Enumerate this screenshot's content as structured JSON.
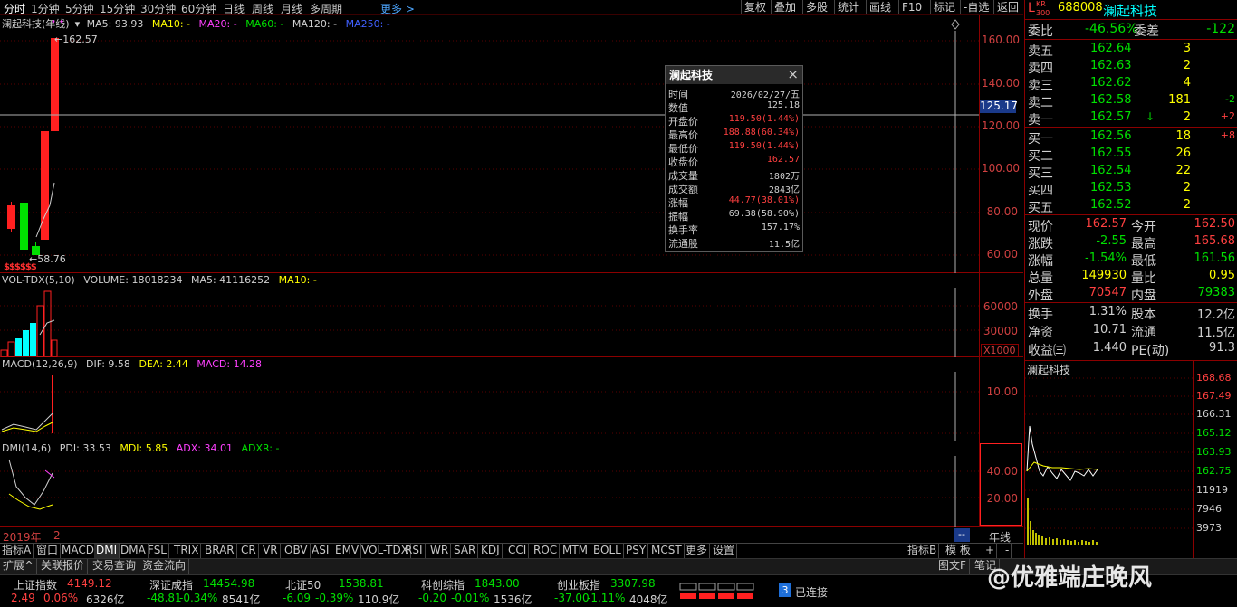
{
  "toolbar": {
    "periods": [
      "分时",
      "1分钟",
      "5分钟",
      "15分钟",
      "30分钟",
      "60分钟",
      "日线",
      "周线",
      "月线",
      "多周期",
      "更多 >"
    ],
    "right_buttons": [
      "复权",
      "叠加",
      "多股",
      "统计",
      "画线",
      "F10",
      "标记",
      "-自选",
      "返回"
    ]
  },
  "main_chart": {
    "stock_label": "澜起科技(年线)",
    "ma5": "MA5: 93.93",
    "ma10": "MA10: -",
    "ma20": "MA20: -",
    "ma60": "MA60: -",
    "ma120": "MA120: -",
    "ma250": "MA250: -",
    "high_annot": "162.57",
    "low_annot": "58.76",
    "cursor_value": "125.17",
    "y_ticks": [
      "160.00",
      "140.00",
      "120.00",
      "100.00",
      "80.00",
      "60.00"
    ],
    "signal_marks": "$$$$$$"
  },
  "vol_chart": {
    "label": "VOL-TDX(5,10)",
    "volume": "VOLUME: 18018234",
    "ma5": "MA5: 41116252",
    "ma10": "MA10: -",
    "y_ticks": [
      "60000",
      "30000"
    ],
    "unit": "X1000"
  },
  "macd_chart": {
    "label": "MACD(12,26,9)",
    "dif": "DIF: 9.58",
    "dea": "DEA: 2.44",
    "macd": "MACD: 14.28",
    "y_ticks": [
      "10.00"
    ]
  },
  "dmi_chart": {
    "label": "DMI(14,6)",
    "pdi": "PDI: 33.53",
    "mdi": "MDI: 5.85",
    "adx": "ADX: 34.01",
    "adxr": "ADXR: -",
    "y_ticks": [
      "40.00",
      "20.00"
    ]
  },
  "x_axis": {
    "year_label": "2019年",
    "year_label2": "2",
    "period_name": "年线",
    "scroll_marker": "--"
  },
  "popup": {
    "title": "澜起科技",
    "close": "×",
    "rows": [
      {
        "k": "时间",
        "v": "2026/02/27/五",
        "c": "#d0d0d0"
      },
      {
        "k": "数值",
        "v": "125.18",
        "c": "#d0d0d0"
      },
      {
        "k": "开盘价",
        "v": "119.50(1.44%)",
        "c": "#ff4040"
      },
      {
        "k": "最高价",
        "v": "188.88(60.34%)",
        "c": "#ff4040"
      },
      {
        "k": "最低价",
        "v": "119.50(1.44%)",
        "c": "#ff4040"
      },
      {
        "k": "收盘价",
        "v": "162.57",
        "c": "#ff4040"
      },
      {
        "k": "成交量",
        "v": "1802万",
        "c": "#d0d0d0"
      },
      {
        "k": "成交额",
        "v": "2843亿",
        "c": "#d0d0d0"
      },
      {
        "k": "涨幅",
        "v": "44.77(38.01%)",
        "c": "#ff4040"
      },
      {
        "k": "振幅",
        "v": "69.38(58.90%)",
        "c": "#d0d0d0"
      },
      {
        "k": "换手率",
        "v": "157.17%",
        "c": "#d0d0d0"
      },
      {
        "k": "流通股",
        "v": "11.5亿",
        "c": "#d0d0d0"
      }
    ]
  },
  "quote": {
    "market_badge": "L",
    "market_badge_sup": "KR",
    "market_badge_sub": "300",
    "code": "688008",
    "name": "澜起科技",
    "weibi_label": "委比",
    "weibi": "-46.56%",
    "weicha_label": "委差",
    "weicha": "-122",
    "asks": [
      {
        "label": "卖五",
        "price": "162.64",
        "vol": "3",
        "chg": ""
      },
      {
        "label": "卖四",
        "price": "162.63",
        "vol": "2",
        "chg": ""
      },
      {
        "label": "卖三",
        "price": "162.62",
        "vol": "4",
        "chg": ""
      },
      {
        "label": "卖二",
        "price": "162.58",
        "vol": "181",
        "chg": "-2"
      },
      {
        "label": "卖一",
        "price": "162.57",
        "vol": "2",
        "chg": "+2"
      }
    ],
    "ask1_arrow": "↓",
    "bids": [
      {
        "label": "买一",
        "price": "162.56",
        "vol": "18",
        "chg": "+8"
      },
      {
        "label": "买二",
        "price": "162.55",
        "vol": "26",
        "chg": ""
      },
      {
        "label": "买三",
        "price": "162.54",
        "vol": "22",
        "chg": ""
      },
      {
        "label": "买四",
        "price": "162.53",
        "vol": "2",
        "chg": ""
      },
      {
        "label": "买五",
        "price": "162.52",
        "vol": "2",
        "chg": ""
      }
    ],
    "stats": [
      {
        "l1": "现价",
        "v1": "162.57",
        "c1": "#ff4040",
        "l2": "今开",
        "v2": "162.50",
        "c2": "#ff4040"
      },
      {
        "l1": "涨跌",
        "v1": "-2.55",
        "c1": "#00e000",
        "l2": "最高",
        "v2": "165.68",
        "c2": "#ff4040"
      },
      {
        "l1": "涨幅",
        "v1": "-1.54%",
        "c1": "#00e000",
        "l2": "最低",
        "v2": "161.56",
        "c2": "#00e000"
      },
      {
        "l1": "总量",
        "v1": "149930",
        "c1": "#ffff00",
        "l2": "量比",
        "v2": "0.95",
        "c2": "#ffff00"
      },
      {
        "l1": "外盘",
        "v1": "70547",
        "c1": "#ff4040",
        "l2": "内盘",
        "v2": "79383",
        "c2": "#00e000"
      }
    ],
    "stats2": [
      {
        "l1": "换手",
        "v1": "1.31%",
        "l2": "股本",
        "v2": "12.2亿"
      },
      {
        "l1": "净资",
        "v1": "10.71",
        "l2": "流通",
        "v2": "11.5亿"
      },
      {
        "l1": "收益㈢",
        "v1": "1.440",
        "l2": "PE(动)",
        "v2": "91.3"
      }
    ]
  },
  "mini": {
    "title": "澜起科技",
    "y_ticks": [
      "168.68",
      "167.49",
      "166.31",
      "165.12",
      "163.93",
      "162.75",
      "11919",
      "7946",
      "3973"
    ]
  },
  "indicator_tabs": [
    "指标A",
    "窗口",
    "MACD",
    "DMI",
    "DMA",
    "FSL",
    "TRIX",
    "BRAR",
    "CR",
    "VR",
    "OBV",
    "ASI",
    "EMV",
    "VOL-TDX",
    "RSI",
    "WR",
    "SAR",
    "KDJ",
    "CCI",
    "ROC",
    "MTM",
    "BOLL",
    "PSY",
    "MCST",
    "更多",
    "设置"
  ],
  "indicator_right": [
    "指标B",
    "模 板",
    "+",
    "-"
  ],
  "bottom_tabs": [
    "扩展^",
    "关联报价",
    "交易查询",
    "资金流向"
  ],
  "bottom_right_tabs": [
    "图文F",
    "笔记"
  ],
  "indices": [
    {
      "name": "上证指数",
      "val": "4149.12",
      "chg": "2.49",
      "pct": "0.06%",
      "amt": "6326亿",
      "up": true
    },
    {
      "name": "深证成指",
      "val": "14454.98",
      "chg": "-48.81",
      "pct": "-0.34%",
      "amt": "8541亿",
      "up": false
    },
    {
      "name": "北证50",
      "val": "1538.81",
      "chg": "-6.09",
      "pct": "-0.39%",
      "amt": "110.9亿",
      "up": false
    },
    {
      "name": "科创综指",
      "val": "1843.00",
      "chg": "-0.20",
      "pct": "-0.01%",
      "amt": "1536亿",
      "up": false
    },
    {
      "name": "创业板指",
      "val": "3307.98",
      "chg": "-37.00",
      "pct": "-1.11%",
      "amt": "4048亿",
      "up": false
    }
  ],
  "status": {
    "conn_count": "3",
    "conn_text": "已连接",
    "watermark": "@优雅端庄晚风"
  },
  "colors": {
    "up": "#ff4040",
    "down": "#00e000",
    "grid": "#8b0000",
    "yellow": "#ffff00",
    "cyan": "#00ffff"
  }
}
